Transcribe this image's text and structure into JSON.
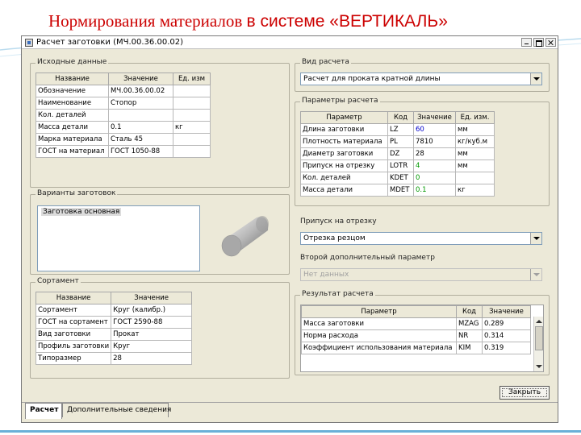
{
  "slide": {
    "title_part1": "Нормирования материалов ",
    "title_part2": "в системе «ВЕРТИКАЛЬ»"
  },
  "window": {
    "title": "Расчет заготовки (МЧ.00.36.00.02)"
  },
  "source": {
    "legend": "Исходные данные",
    "headers": [
      "Название",
      "Значение",
      "Ед. изм"
    ],
    "rows": [
      [
        "Обозначение",
        "МЧ.00.36.00.02",
        ""
      ],
      [
        "Наименование",
        "Стопор",
        ""
      ],
      [
        "Кол. деталей",
        "",
        ""
      ],
      [
        "Масса детали",
        "0.1",
        "кг"
      ],
      [
        "Марка материала",
        "Сталь 45",
        ""
      ],
      [
        "ГОСТ на материал",
        "ГОСТ 1050-88",
        ""
      ]
    ]
  },
  "blanks": {
    "legend": "Варианты заготовок",
    "items": [
      "Заготовка основная"
    ]
  },
  "assortment": {
    "legend": "Сортамент",
    "headers": [
      "Название",
      "Значение"
    ],
    "rows": [
      [
        "Сортамент",
        "Круг (калибр.)"
      ],
      [
        "ГОСТ на сортамент",
        "ГОСТ 2590-88"
      ],
      [
        "Вид заготовки",
        "Прокат"
      ],
      [
        "Профиль заготовки",
        "Круг"
      ],
      [
        "Типоразмер",
        "28"
      ]
    ]
  },
  "calc_type": {
    "legend": "Вид расчета",
    "value": "Расчет для проката кратной длины"
  },
  "params": {
    "legend": "Параметры расчета",
    "headers": [
      "Параметр",
      "Код",
      "Значение",
      "Ед. изм."
    ],
    "rows": [
      [
        "Длина заготовки",
        "LZ",
        "60",
        "мм"
      ],
      [
        "Плотность материала",
        "PL",
        "7810",
        "кг/куб.м"
      ],
      [
        "Диаметр заготовки",
        "DZ",
        "28",
        "мм"
      ],
      [
        "Припуск на отрезку",
        "LOTR",
        "4",
        "мм"
      ],
      [
        "Кол. деталей",
        "KDET",
        "0",
        ""
      ],
      [
        "Масса детали",
        "MDET",
        "0.1",
        "кг"
      ]
    ]
  },
  "allowance": {
    "label": "Припуск на отрезку",
    "value": "Отрезка резцом"
  },
  "second_param": {
    "label": "Второй дополнительный параметр",
    "value": "Нет данных"
  },
  "result": {
    "legend": "Результат расчета",
    "headers": [
      "Параметр",
      "Код",
      "Значение"
    ],
    "rows": [
      [
        "Масса заготовки",
        "MZAG",
        "0.289"
      ],
      [
        "Норма расхода",
        "NR",
        "0.314"
      ],
      [
        "Коэффициент использования материала",
        "KIM",
        "0.319"
      ]
    ]
  },
  "buttons": {
    "close": "Закрыть"
  },
  "tabs": [
    "Расчет",
    "Дополнительные сведения"
  ],
  "colors": {
    "title_red": "#cc0000",
    "window_bg": "#ece9d8",
    "value_blue": "#0000cc",
    "value_green": "#009900"
  }
}
